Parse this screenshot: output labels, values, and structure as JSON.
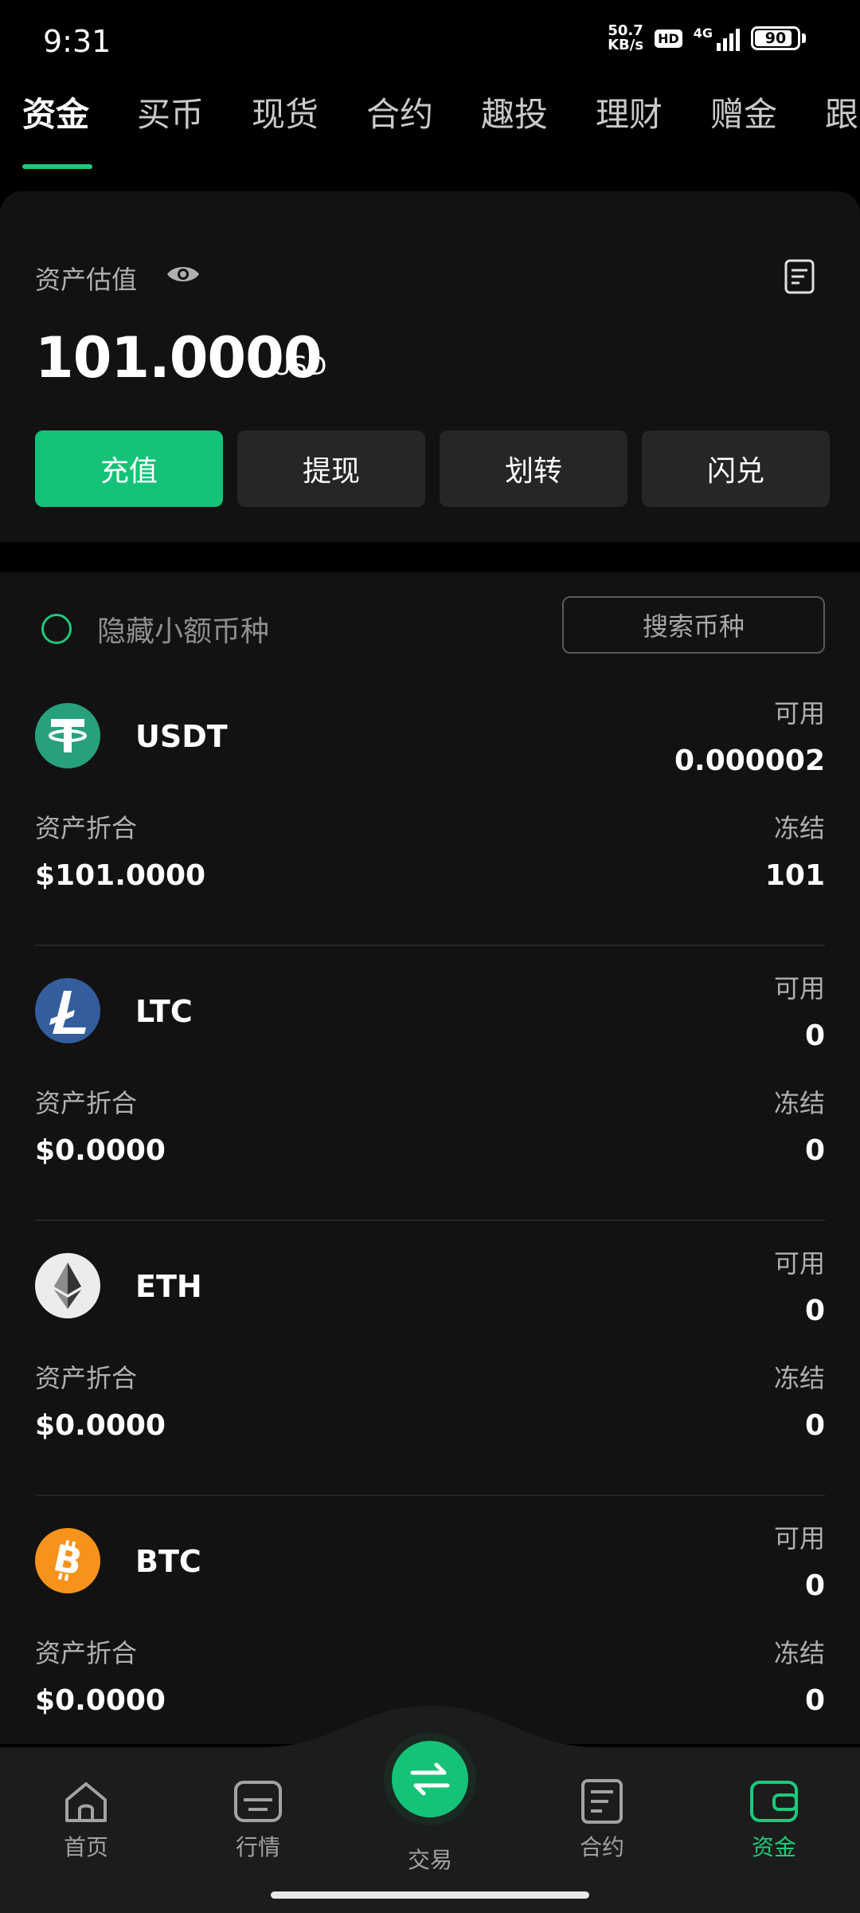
{
  "status_bar": {
    "time": "9:31",
    "net_speed_value": "50.7",
    "net_speed_unit": "KB/s",
    "hd": "HD",
    "network": "4G",
    "battery_level": "90",
    "battery_fraction": 0.9
  },
  "tabs": [
    {
      "label": "资金",
      "active": true
    },
    {
      "label": "买币"
    },
    {
      "label": "现货"
    },
    {
      "label": "合约"
    },
    {
      "label": "趣投"
    },
    {
      "label": "理财"
    },
    {
      "label": "赠金"
    },
    {
      "label": "跟"
    }
  ],
  "asset": {
    "label": "资产估值",
    "value": "101.0000",
    "unit": "USD",
    "actions": [
      "充值",
      "提现",
      "划转",
      "闪兑"
    ]
  },
  "filter": {
    "hide_small_label": "隐藏小额币种",
    "search_label": "搜索币种"
  },
  "coins": [
    {
      "name": "USDT",
      "available_label": "可用",
      "available": "0.000002",
      "conv_label": "资产折合",
      "conv_value": "$101.0000",
      "frozen_label": "冻结",
      "frozen": "101",
      "icon": "tether-icon",
      "color": "#26a17b"
    },
    {
      "name": "LTC",
      "available_label": "可用",
      "available": "0",
      "conv_label": "资产折合",
      "conv_value": "$0.0000",
      "frozen_label": "冻结",
      "frozen": "0",
      "icon": "litecoin-icon",
      "color": "#345d9d"
    },
    {
      "name": "ETH",
      "available_label": "可用",
      "available": "0",
      "conv_label": "资产折合",
      "conv_value": "$0.0000",
      "frozen_label": "冻结",
      "frozen": "0",
      "icon": "ethereum-icon",
      "color": "#ececec"
    },
    {
      "name": "BTC",
      "available_label": "可用",
      "available": "0",
      "conv_label": "资产折合",
      "conv_value": "$0.0000",
      "frozen_label": "冻结",
      "frozen": "0",
      "icon": "bitcoin-icon",
      "color": "#f7931a"
    }
  ],
  "bottom_nav": {
    "items": [
      {
        "label": "首页",
        "icon": "home-icon"
      },
      {
        "label": "行情",
        "icon": "market-icon"
      },
      {
        "label": "交易",
        "icon": "swap-icon"
      },
      {
        "label": "合约",
        "icon": "contract-icon"
      },
      {
        "label": "资金",
        "icon": "wallet-icon",
        "active": true
      }
    ]
  },
  "colors": {
    "accent": "#14c377",
    "background": "#000000",
    "card": "#121212"
  }
}
